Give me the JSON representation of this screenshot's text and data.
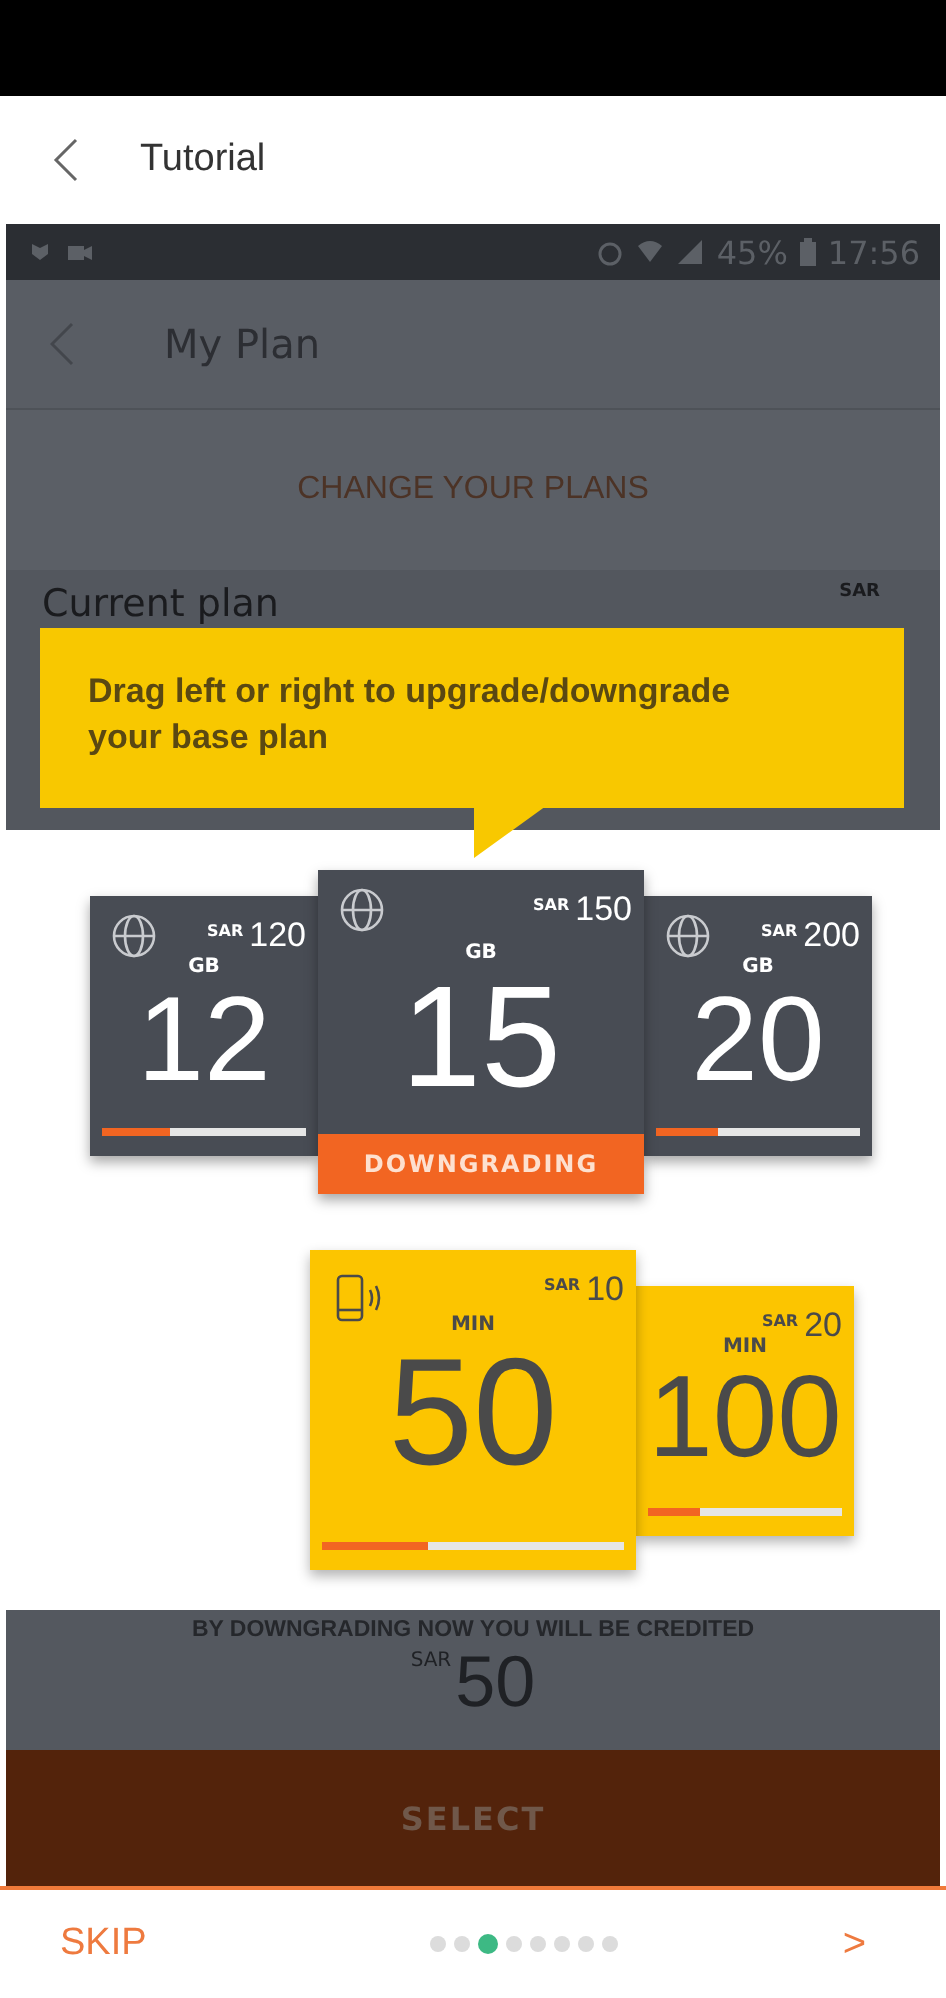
{
  "header": {
    "title": "Tutorial"
  },
  "screenshot": {
    "status_bar": {
      "battery": "45%",
      "time": "17:56"
    },
    "app_bar": {
      "title": "My Plan"
    },
    "section_title": "CHANGE YOUR PLANS",
    "current_plan": {
      "label": "Current plan",
      "currency": "SAR"
    },
    "tooltip": "Drag left or right to upgrade/downgrade your base plan",
    "data_plans": [
      {
        "unit": "GB",
        "amount": "12",
        "currency": "SAR",
        "price": "120",
        "selected": false,
        "level": 0.33
      },
      {
        "unit": "GB",
        "amount": "15",
        "currency": "SAR",
        "price": "150",
        "selected": true,
        "status": "DOWNGRADING"
      },
      {
        "unit": "GB",
        "amount": "20",
        "currency": "SAR",
        "price": "200",
        "selected": false,
        "level": 0.3
      }
    ],
    "minute_plans": [
      {
        "unit": "MIN",
        "amount": "50",
        "currency": "SAR",
        "price": "10",
        "selected": true,
        "level": 0.35
      },
      {
        "unit": "MIN",
        "amount": "100",
        "currency": "SAR",
        "price": "20",
        "selected": false,
        "level": 0.27
      }
    ],
    "credit_note": "BY DOWNGRADING NOW YOU WILL BE CREDITED",
    "credit": {
      "currency": "SAR",
      "amount": "50"
    },
    "select_button": "SELECT"
  },
  "footer": {
    "skip": "SKIP",
    "pages": [
      {
        "selected": false
      },
      {
        "selected": false
      },
      {
        "selected": true
      },
      {
        "selected": false
      },
      {
        "selected": false
      },
      {
        "selected": false
      },
      {
        "selected": false
      },
      {
        "selected": false
      }
    ],
    "next": ">"
  }
}
